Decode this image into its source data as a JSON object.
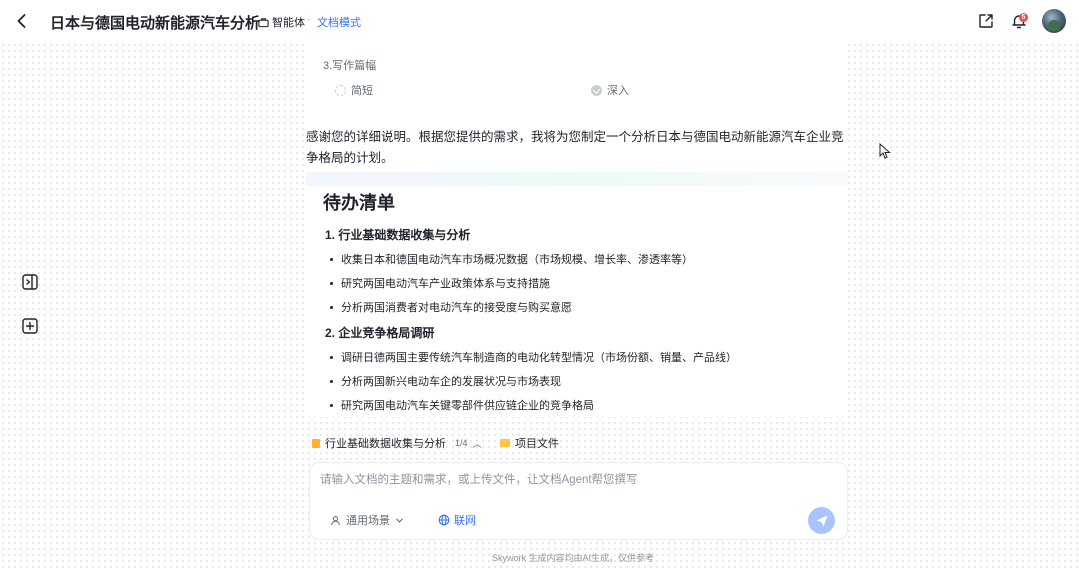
{
  "header": {
    "title": "日本与德国电动新能源汽车分析",
    "agent_label": "智能体",
    "separator": "·",
    "mode_label": "文档模式",
    "notification_count": "5"
  },
  "settings": {
    "length_label": "3.写作篇幅",
    "options": [
      {
        "label": "简短",
        "selected": false
      },
      {
        "label": "深入",
        "selected": true
      }
    ]
  },
  "message": {
    "intro": "感谢您的详细说明。根据您提供的需求，我将为您制定一个分析日本与德国电动新能源汽车企业竞争格局的计划。"
  },
  "todo": {
    "title": "待办清单",
    "groups": [
      {
        "title": "1. 行业基础数据收集与分析",
        "items": [
          "收集日本和德国电动汽车市场概况数据（市场规模、增长率、渗透率等）",
          "研究两国电动汽车产业政策体系与支持措施",
          "分析两国消费者对电动汽车的接受度与购买意愿"
        ]
      },
      {
        "title": "2. 企业竞争格局调研",
        "items": [
          "调研日德两国主要传统汽车制造商的电动化转型情况（市场份额、销量、产品线）",
          "分析两国新兴电动车企的发展状况与市场表现",
          "研究两国电动汽车关键零部件供应链企业的竞争格局"
        ]
      }
    ]
  },
  "task_bar": {
    "current_task": "行业基础数据收集与分析",
    "progress": "1/4",
    "files_label": "项目文件"
  },
  "composer": {
    "placeholder": "请输入文档的主题和需求，或上传文件，让文档Agent帮您撰写",
    "scene_label": "通用场景",
    "network_label": "联网"
  },
  "footer": {
    "disclaimer": "Skywork 生成内容均由AI生成，仅供参考"
  },
  "colors": {
    "accent": "#3370ff",
    "send_button": "#a8c5ff",
    "badge": "#f54a45"
  }
}
